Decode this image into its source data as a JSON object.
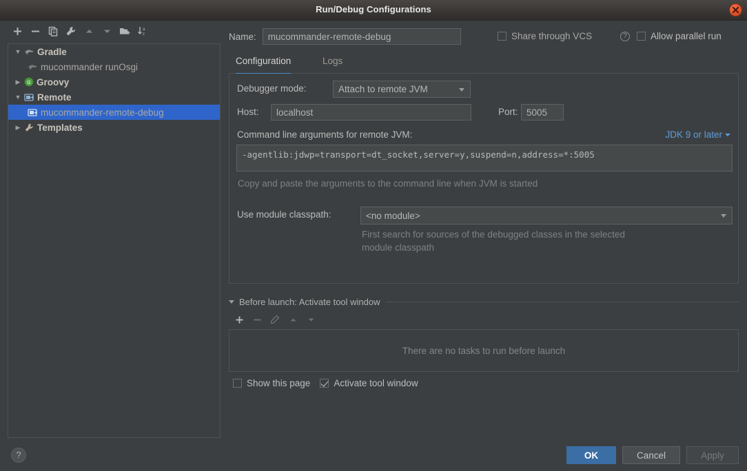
{
  "window": {
    "title": "Run/Debug Configurations",
    "close_icon": "close-icon"
  },
  "left_panel": {
    "toolbar": [
      {
        "icon": "add-icon",
        "label": "Add New Configuration"
      },
      {
        "icon": "remove-icon",
        "label": "Remove Configuration"
      },
      {
        "icon": "copy-icon",
        "label": "Copy Configuration"
      },
      {
        "icon": "edit-templates-icon",
        "label": "Edit Templates"
      },
      {
        "icon": "move-up-icon",
        "label": "Move Up"
      },
      {
        "icon": "move-down-icon",
        "label": "Move Down"
      },
      {
        "icon": "new-folder-icon",
        "label": "Create New Folder"
      },
      {
        "icon": "sort-alphabetically-icon",
        "label": "Sort Configurations"
      }
    ],
    "tree": [
      {
        "label": "Gradle",
        "icon": "gradle-elephant-icon",
        "indent": 0,
        "twisty": "expanded",
        "group": true,
        "selected": false
      },
      {
        "label": "mucommander runOsgi",
        "icon": "gradle-elephant-icon",
        "indent": 1,
        "twisty": "none",
        "group": false,
        "selected": false
      },
      {
        "label": "Groovy",
        "icon": "groovy-icon",
        "indent": 0,
        "twisty": "collapsed",
        "group": true,
        "selected": false
      },
      {
        "label": "Remote",
        "icon": "remote-debug-icon",
        "indent": 0,
        "twisty": "expanded",
        "group": true,
        "selected": false
      },
      {
        "label": "mucommander-remote-debug",
        "icon": "remote-debug-icon",
        "indent": 1,
        "twisty": "none",
        "group": false,
        "selected": true
      },
      {
        "label": "Templates",
        "icon": "wrench-icon",
        "indent": 0,
        "twisty": "collapsed",
        "group": true,
        "selected": false
      }
    ]
  },
  "header": {
    "name_label": "Name:",
    "name_value": "mucommander-remote-debug",
    "share_vcs_label": "Share through VCS",
    "share_vcs_checked": false,
    "share_vcs_help_icon": "question-mark-icon",
    "allow_parallel_label": "Allow parallel run",
    "allow_parallel_checked": false
  },
  "tabs": [
    {
      "label": "Configuration",
      "active": true
    },
    {
      "label": "Logs",
      "active": false
    }
  ],
  "config": {
    "debugger_mode_label": "Debugger mode:",
    "debugger_mode_value": "Attach to remote JVM",
    "host_label": "Host:",
    "host_value": "localhost",
    "port_label": "Port:",
    "port_value": "5005",
    "cmdline_label": "Command line arguments for remote JVM:",
    "jdk_link": "JDK 9 or later",
    "jdk_link_icon": "chevron-down-icon",
    "cmdline_value": "-agentlib:jdwp=transport=dt_socket,server=y,suspend=n,address=*:5005",
    "cmdline_hint": "Copy and paste the arguments to the command line when JVM is started",
    "module_classpath_label": "Use module classpath:",
    "module_classpath_value": "<no module>",
    "module_classpath_hint_line1": "First search for sources of the debugged classes in the selected",
    "module_classpath_hint_line2": "module classpath"
  },
  "before_launch": {
    "title": "Before launch: Activate tool window",
    "twisty": "expanded",
    "toolbar": [
      {
        "icon": "add-icon",
        "enabled": true
      },
      {
        "icon": "remove-icon",
        "enabled": false
      },
      {
        "icon": "edit-icon",
        "enabled": false
      },
      {
        "icon": "move-up-icon",
        "enabled": false
      },
      {
        "icon": "move-down-icon",
        "enabled": false
      }
    ],
    "empty_text": "There are no tasks to run before launch",
    "show_page_label": "Show this page",
    "show_page_checked": false,
    "activate_tool_window_label": "Activate tool window",
    "activate_tool_window_checked": true
  },
  "footer": {
    "help_icon": "question-mark-icon",
    "ok_label": "OK",
    "cancel_label": "Cancel",
    "apply_label": "Apply",
    "apply_enabled": false
  },
  "colors": {
    "window_bg": "#3c3f41",
    "panel_border": "#4e5254",
    "selection_blue": "#2f65ca",
    "accent_blue": "#4a88c7",
    "link_blue": "#5f9ede",
    "primary_button": "#3a6ea5",
    "close_button": "#e0542c",
    "groovy_green": "#4d9f3f",
    "text_primary": "#bbbbbb",
    "text_dim": "#7e8082"
  }
}
